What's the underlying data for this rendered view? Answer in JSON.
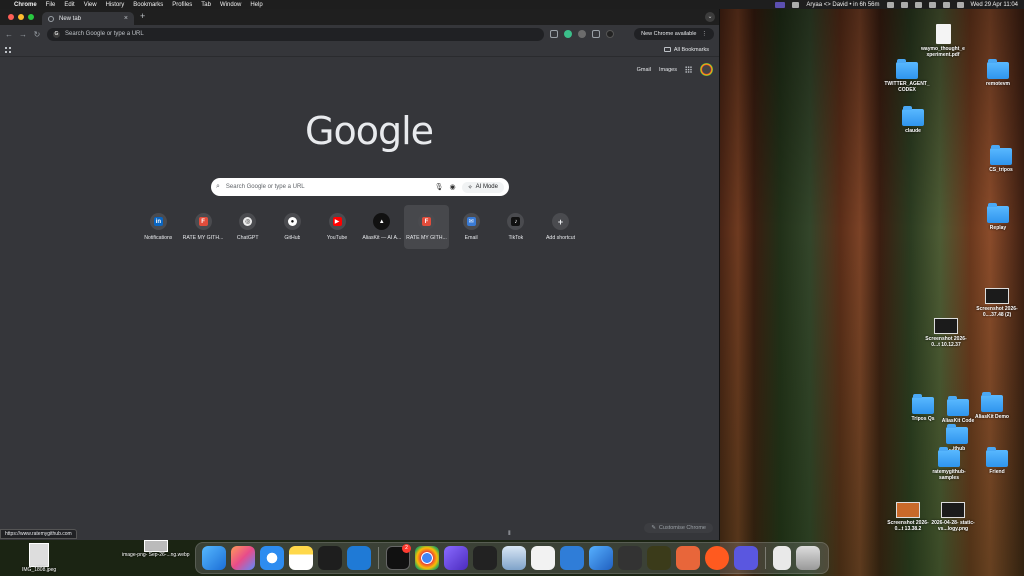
{
  "menubar": {
    "app_name": "Chrome",
    "menus": [
      "File",
      "Edit",
      "View",
      "History",
      "Bookmarks",
      "Profiles",
      "Tab",
      "Window",
      "Help"
    ],
    "status_text": "Aryaa <> David • in 6h 56m",
    "datetime": "Wed 29 Apr  11:04"
  },
  "chrome": {
    "tab_title": "New tab",
    "omnibox_placeholder": "Search Google or type a URL",
    "update_label": "New Chrome available",
    "all_bookmarks": "All Bookmarks",
    "gmail": "Gmail",
    "images": "Images",
    "logo": "Google",
    "search_placeholder": "Search Google or type a URL",
    "ai_mode": "AI Mode",
    "shortcuts": [
      {
        "label": "Notifications",
        "glyph": "in",
        "bg": "#0a66c2"
      },
      {
        "label": "RATE MY GITH...",
        "glyph": "F",
        "bg": "#e24c3b"
      },
      {
        "label": "ChatGPT",
        "glyph": "◎",
        "bg": "#ececec"
      },
      {
        "label": "GitHub",
        "glyph": "●",
        "bg": "#ffffff"
      },
      {
        "label": "YouTube",
        "glyph": "▶",
        "bg": "#ff0000"
      },
      {
        "label": "AliasKit — AI A...",
        "glyph": "▲",
        "bg": "#111111"
      },
      {
        "label": "RATE MY GITH...",
        "glyph": "F",
        "bg": "#e24c3b"
      },
      {
        "label": "Email",
        "glyph": "✉",
        "bg": "#3a7bd5"
      },
      {
        "label": "TikTok",
        "glyph": "♪",
        "bg": "#111111"
      },
      {
        "label": "Add shortcut",
        "glyph": "+",
        "bg": "transparent"
      }
    ],
    "status_url": "https://www.ratemygithub.com",
    "customise": "Customise Chrome"
  },
  "desktop": {
    "items": [
      {
        "label": "waymo_thought_e xperiment.pdf",
        "kind": "doc"
      },
      {
        "label": "TWITTER_AGENT_ CODEX",
        "kind": "folder"
      },
      {
        "label": "remotevm",
        "kind": "folder"
      },
      {
        "label": "claude",
        "kind": "folder"
      },
      {
        "label": "CS_tripos",
        "kind": "folder"
      },
      {
        "label": "Replay",
        "kind": "folder"
      },
      {
        "label": "Screenshot 2026-0....37.48 (2)",
        "kind": "shot"
      },
      {
        "label": "Screenshot 2026-0...t 10.12.37",
        "kind": "shot"
      },
      {
        "label": "Tripos Qs",
        "kind": "folder"
      },
      {
        "label": "AliasKit Code",
        "kind": "folder"
      },
      {
        "label": "AliasKit Demo",
        "kind": "folder"
      },
      {
        "label": "...ithub",
        "kind": "folder"
      },
      {
        "label": "ratemygithub- samples",
        "kind": "folder"
      },
      {
        "label": "Friend",
        "kind": "folder"
      },
      {
        "label": "Screenshot 2026-0...t 13.38.2",
        "kind": "shot"
      },
      {
        "label": "2026-04-28- static-vs...logy.png",
        "kind": "shot"
      }
    ],
    "bottom_left": [
      {
        "label": "IMG_1808.jpeg"
      },
      {
        "label": "image-png- Sep-26-...ng.webp"
      }
    ]
  },
  "dock": {
    "badge_count": "2"
  }
}
